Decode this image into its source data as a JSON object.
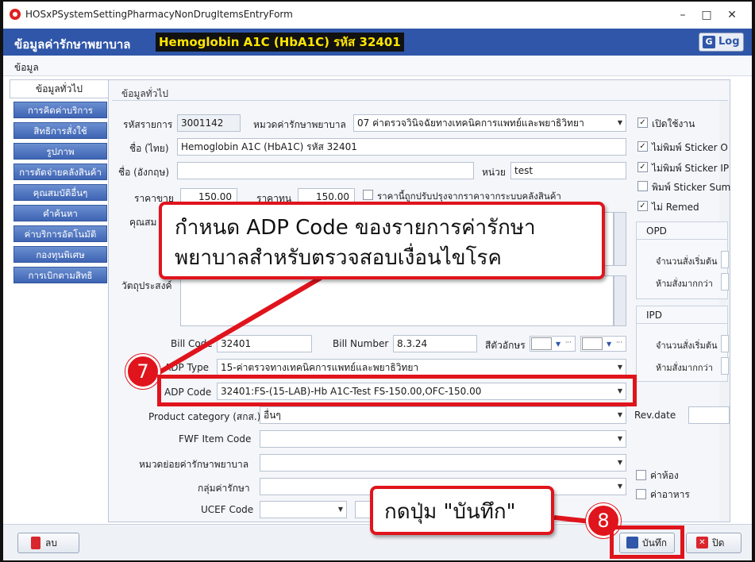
{
  "window": {
    "title": "HOSxPSystemSettingPharmacyNonDrugItemsEntryForm",
    "minimize_glyph": "–",
    "maximize_glyph": "□",
    "close_glyph": "✕"
  },
  "header": {
    "label": "ข้อมูลค่ารักษาพยาบาล",
    "item_name": "Hemoglobin A1C (HbA1C) รหัส 32401",
    "log_button": "Log",
    "log_icon": "G"
  },
  "menu": {
    "item": "ข้อมูล"
  },
  "sidebar": {
    "active_tab": "ข้อมูลทั่วไป",
    "items": [
      "การคิดค่าบริการ",
      "สิทธิการสั่งใช้",
      "รูปภาพ",
      "การตัดจ่ายคลังสินค้า",
      "คุณสมบัติอื่นๆ",
      "คำค้นหา",
      "ค่าบริการอัตโนมัติ",
      "กองทุนพิเศษ",
      "การเบิกตามสิทธิ"
    ]
  },
  "panel": {
    "tab_title": "ข้อมูลทั่วไป",
    "item_code_label": "รหัสรายการ",
    "item_code": "3001142",
    "category_label": "หมวดค่ารักษาพยาบาล",
    "category": "07 ค่าตรวจวินิจฉัยทางเทคนิคการแพทย์และพยาธิวิทยา",
    "name_th_label": "ชื่อ (ไทย)",
    "name_th": "Hemoglobin A1C (HbA1C) รหัส 32401",
    "name_en_label": "ชื่อ (อังกฤษ)",
    "name_en": "",
    "unit_label": "หน่วย",
    "unit": "test",
    "sale_price_label": "ราคาขาย",
    "sale_price": "150.00",
    "cost_price_label": "ราคาทุน",
    "cost_price": "150.00",
    "price_adjust_label": "ราคานี้ถูกปรับปรุงจากราคาจากระบบคลังสินค้า",
    "properties_label": "คุณสม",
    "purpose_label": "วัตถุประสงค์",
    "bill_code_label": "Bill Code",
    "bill_code": "32401",
    "bill_number_label": "Bill Number",
    "bill_number": "8.3.24",
    "text_color_label": "สีตัวอักษร",
    "adp_type_label": "ADP Type",
    "adp_type": "15-ค่าตรวจทางเทคนิคการแพทย์และพยาธิวิทยา",
    "adp_code_label": "ADP Code",
    "adp_code": "32401:FS-(15-LAB)-Hb A1C-Test FS-150.00,OFC-150.00",
    "product_category_label": "Product category (สกส.)",
    "product_category": "อื่นๆ",
    "rev_date_label": "Rev.date",
    "fwf_label": "FWF Item Code",
    "subcategory_label": "หมวดย่อยค่ารักษาพยาบาล",
    "group_label": "กลุ่มค่ารักษา",
    "ucef_label": "UCEF Code"
  },
  "right_options": {
    "checks": [
      {
        "label": "เปิดใช้งาน",
        "checked": true
      },
      {
        "label": "ไม่พิมพ์ Sticker O",
        "checked": true
      },
      {
        "label": "ไม่พิมพ์ Sticker IP",
        "checked": true
      },
      {
        "label": "พิมพ์ Sticker Sum",
        "checked": false
      },
      {
        "label": "ไม่ Remed",
        "checked": true
      }
    ],
    "opd_title": "OPD",
    "ipd_title": "IPD",
    "start_qty_label": "จำนวนสั่งเริ่มต้น",
    "max_qty_label": "ห้ามสั่งมากกว่า",
    "room_fee_label": "ค่าห้อง",
    "food_fee_label": "ค่าอาหาร"
  },
  "footer": {
    "delete_button": "ลบ",
    "save_button": "บันทึก",
    "close_button": "ปิด"
  },
  "annotations": {
    "callout_7_line1": "กำหนด ADP Code ของรายการค่ารักษา",
    "callout_7_line2": "พยาบาลสำหรับตรวจสอบเงื่อนไขโรค",
    "step_7": "7",
    "callout_8": "กดปุ่ม \"บันทึก\"",
    "step_8": "8"
  },
  "colors": {
    "header_blue": "#2f56a8",
    "highlight_yellow": "#ffe600",
    "annotation_red": "#e0141c"
  }
}
